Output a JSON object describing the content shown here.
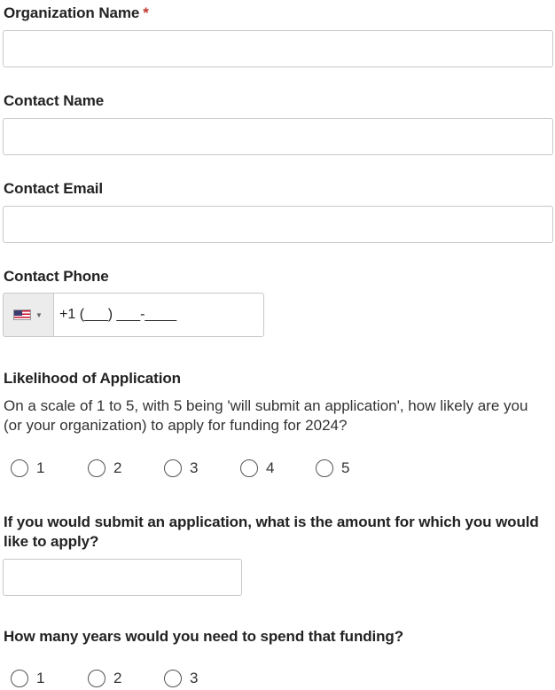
{
  "organization_name": {
    "label": "Organization Name",
    "required_mark": "*",
    "value": ""
  },
  "contact_name": {
    "label": "Contact Name",
    "value": ""
  },
  "contact_email": {
    "label": "Contact Email",
    "value": ""
  },
  "contact_phone": {
    "label": "Contact Phone",
    "country_flag": "us-flag-icon",
    "mask": "+1 (___) ___-____"
  },
  "likelihood": {
    "label": "Likelihood of Application",
    "description": "On a scale of 1 to 5, with 5 being 'will submit an application', how likely are you (or your organization) to apply for funding for 2024?",
    "options": [
      "1",
      "2",
      "3",
      "4",
      "5"
    ]
  },
  "amount": {
    "label": "If you would submit an application, what is the amount for which you would like to apply?",
    "value": ""
  },
  "years": {
    "label": "How many years would you need to spend that funding?",
    "options": [
      "1",
      "2",
      "3"
    ]
  },
  "colors": {
    "required": "#c0392b",
    "border": "#c8c8c8"
  }
}
